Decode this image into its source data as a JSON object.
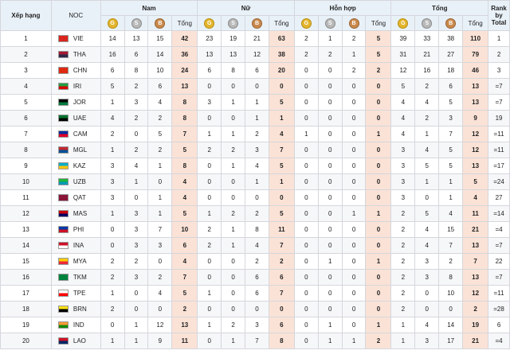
{
  "headers": {
    "rank": "Xếp hạng",
    "noc": "NOC",
    "groups": [
      "Nam",
      "Nữ",
      "Hỗn hợp",
      "Tổng"
    ],
    "medal_letters": [
      "G",
      "S",
      "B"
    ],
    "total": "Tổng",
    "rank_by_total": "Rank by Total"
  },
  "colors": {
    "gold": "#e3b52d",
    "silver": "#b8b8b8",
    "bronze": "#c98a4d",
    "total_highlight": "#fbe2d6",
    "header_bg": "#e9f1f8"
  },
  "rows": [
    {
      "rank": "1",
      "noc": "VIE",
      "flag": [
        "#da251d",
        "#da251d"
      ],
      "v": [
        "14",
        "13",
        "15",
        "42",
        "23",
        "19",
        "21",
        "63",
        "2",
        "1",
        "2",
        "5",
        "39",
        "33",
        "38",
        "110"
      ],
      "rbt": "1"
    },
    {
      "rank": "2",
      "noc": "THA",
      "flag": [
        "#a51931",
        "#2d2a4a"
      ],
      "v": [
        "16",
        "6",
        "14",
        "36",
        "13",
        "13",
        "12",
        "38",
        "2",
        "2",
        "1",
        "5",
        "31",
        "21",
        "27",
        "79"
      ],
      "rbt": "2"
    },
    {
      "rank": "3",
      "noc": "CHN",
      "flag": [
        "#de2910",
        "#de2910"
      ],
      "v": [
        "6",
        "8",
        "10",
        "24",
        "6",
        "8",
        "6",
        "20",
        "0",
        "0",
        "2",
        "2",
        "12",
        "16",
        "18",
        "46"
      ],
      "rbt": "3"
    },
    {
      "rank": "4",
      "noc": "IRI",
      "flag": [
        "#239f40",
        "#da0000"
      ],
      "v": [
        "5",
        "2",
        "6",
        "13",
        "0",
        "0",
        "0",
        "0",
        "0",
        "0",
        "0",
        "0",
        "5",
        "2",
        "6",
        "13"
      ],
      "rbt": "=7"
    },
    {
      "rank": "5",
      "noc": "JOR",
      "flag": [
        "#000000",
        "#007a3d"
      ],
      "v": [
        "1",
        "3",
        "4",
        "8",
        "3",
        "1",
        "1",
        "5",
        "0",
        "0",
        "0",
        "0",
        "4",
        "4",
        "5",
        "13"
      ],
      "rbt": "=7"
    },
    {
      "rank": "6",
      "noc": "UAE",
      "flag": [
        "#00732f",
        "#000000"
      ],
      "v": [
        "4",
        "2",
        "2",
        "8",
        "0",
        "0",
        "1",
        "1",
        "0",
        "0",
        "0",
        "0",
        "4",
        "2",
        "3",
        "9"
      ],
      "rbt": "19"
    },
    {
      "rank": "7",
      "noc": "CAM",
      "flag": [
        "#032ea1",
        "#e00025"
      ],
      "v": [
        "2",
        "0",
        "5",
        "7",
        "1",
        "1",
        "2",
        "4",
        "1",
        "0",
        "0",
        "1",
        "4",
        "1",
        "7",
        "12"
      ],
      "rbt": "=11"
    },
    {
      "rank": "8",
      "noc": "MGL",
      "flag": [
        "#c4272f",
        "#015197"
      ],
      "v": [
        "1",
        "2",
        "2",
        "5",
        "2",
        "2",
        "3",
        "7",
        "0",
        "0",
        "0",
        "0",
        "3",
        "4",
        "5",
        "12"
      ],
      "rbt": "=11"
    },
    {
      "rank": "9",
      "noc": "KAZ",
      "flag": [
        "#00afca",
        "#fec50c"
      ],
      "v": [
        "3",
        "4",
        "1",
        "8",
        "0",
        "1",
        "4",
        "5",
        "0",
        "0",
        "0",
        "0",
        "3",
        "5",
        "5",
        "13"
      ],
      "rbt": "=17"
    },
    {
      "rank": "10",
      "noc": "UZB",
      "flag": [
        "#1eb53a",
        "#0099b5"
      ],
      "v": [
        "3",
        "1",
        "0",
        "4",
        "0",
        "0",
        "1",
        "1",
        "0",
        "0",
        "0",
        "0",
        "3",
        "1",
        "1",
        "5"
      ],
      "rbt": "=24"
    },
    {
      "rank": "11",
      "noc": "QAT",
      "flag": [
        "#8a1538",
        "#8a1538"
      ],
      "v": [
        "3",
        "0",
        "1",
        "4",
        "0",
        "0",
        "0",
        "0",
        "0",
        "0",
        "0",
        "0",
        "3",
        "0",
        "1",
        "4"
      ],
      "rbt": "27"
    },
    {
      "rank": "12",
      "noc": "MAS",
      "flag": [
        "#cc0001",
        "#010066"
      ],
      "v": [
        "1",
        "3",
        "1",
        "5",
        "1",
        "2",
        "2",
        "5",
        "0",
        "0",
        "1",
        "1",
        "2",
        "5",
        "4",
        "11"
      ],
      "rbt": "=14"
    },
    {
      "rank": "13",
      "noc": "PHI",
      "flag": [
        "#0038a8",
        "#ce1126"
      ],
      "v": [
        "0",
        "3",
        "7",
        "10",
        "2",
        "1",
        "8",
        "11",
        "0",
        "0",
        "0",
        "0",
        "2",
        "4",
        "15",
        "21"
      ],
      "rbt": "=4"
    },
    {
      "rank": "14",
      "noc": "INA",
      "flag": [
        "#ce1126",
        "#ffffff"
      ],
      "v": [
        "0",
        "3",
        "3",
        "6",
        "2",
        "1",
        "4",
        "7",
        "0",
        "0",
        "0",
        "0",
        "2",
        "4",
        "7",
        "13"
      ],
      "rbt": "=7"
    },
    {
      "rank": "15",
      "noc": "MYA",
      "flag": [
        "#fecb00",
        "#ea2839"
      ],
      "v": [
        "2",
        "2",
        "0",
        "4",
        "0",
        "0",
        "2",
        "2",
        "0",
        "1",
        "0",
        "1",
        "2",
        "3",
        "2",
        "7"
      ],
      "rbt": "22"
    },
    {
      "rank": "16",
      "noc": "TKM",
      "flag": [
        "#00843d",
        "#00843d"
      ],
      "v": [
        "2",
        "3",
        "2",
        "7",
        "0",
        "0",
        "6",
        "6",
        "0",
        "0",
        "0",
        "0",
        "2",
        "3",
        "8",
        "13"
      ],
      "rbt": "=7"
    },
    {
      "rank": "17",
      "noc": "TPE",
      "flag": [
        "#ffffff",
        "#fe0000"
      ],
      "v": [
        "1",
        "0",
        "4",
        "5",
        "1",
        "0",
        "6",
        "7",
        "0",
        "0",
        "0",
        "0",
        "2",
        "0",
        "10",
        "12"
      ],
      "rbt": "=11"
    },
    {
      "rank": "18",
      "noc": "BRN",
      "flag": [
        "#f7e017",
        "#000000"
      ],
      "v": [
        "2",
        "0",
        "0",
        "2",
        "0",
        "0",
        "0",
        "0",
        "0",
        "0",
        "0",
        "0",
        "2",
        "0",
        "0",
        "2"
      ],
      "rbt": "=28"
    },
    {
      "rank": "19",
      "noc": "IND",
      "flag": [
        "#ff9933",
        "#138808"
      ],
      "v": [
        "0",
        "1",
        "12",
        "13",
        "1",
        "2",
        "3",
        "6",
        "0",
        "1",
        "0",
        "1",
        "1",
        "4",
        "14",
        "19"
      ],
      "rbt": "6"
    },
    {
      "rank": "20",
      "noc": "LAO",
      "flag": [
        "#ce1126",
        "#002868"
      ],
      "v": [
        "1",
        "1",
        "9",
        "11",
        "0",
        "1",
        "7",
        "8",
        "0",
        "1",
        "1",
        "2",
        "1",
        "3",
        "17",
        "21"
      ],
      "rbt": "=4"
    }
  ]
}
